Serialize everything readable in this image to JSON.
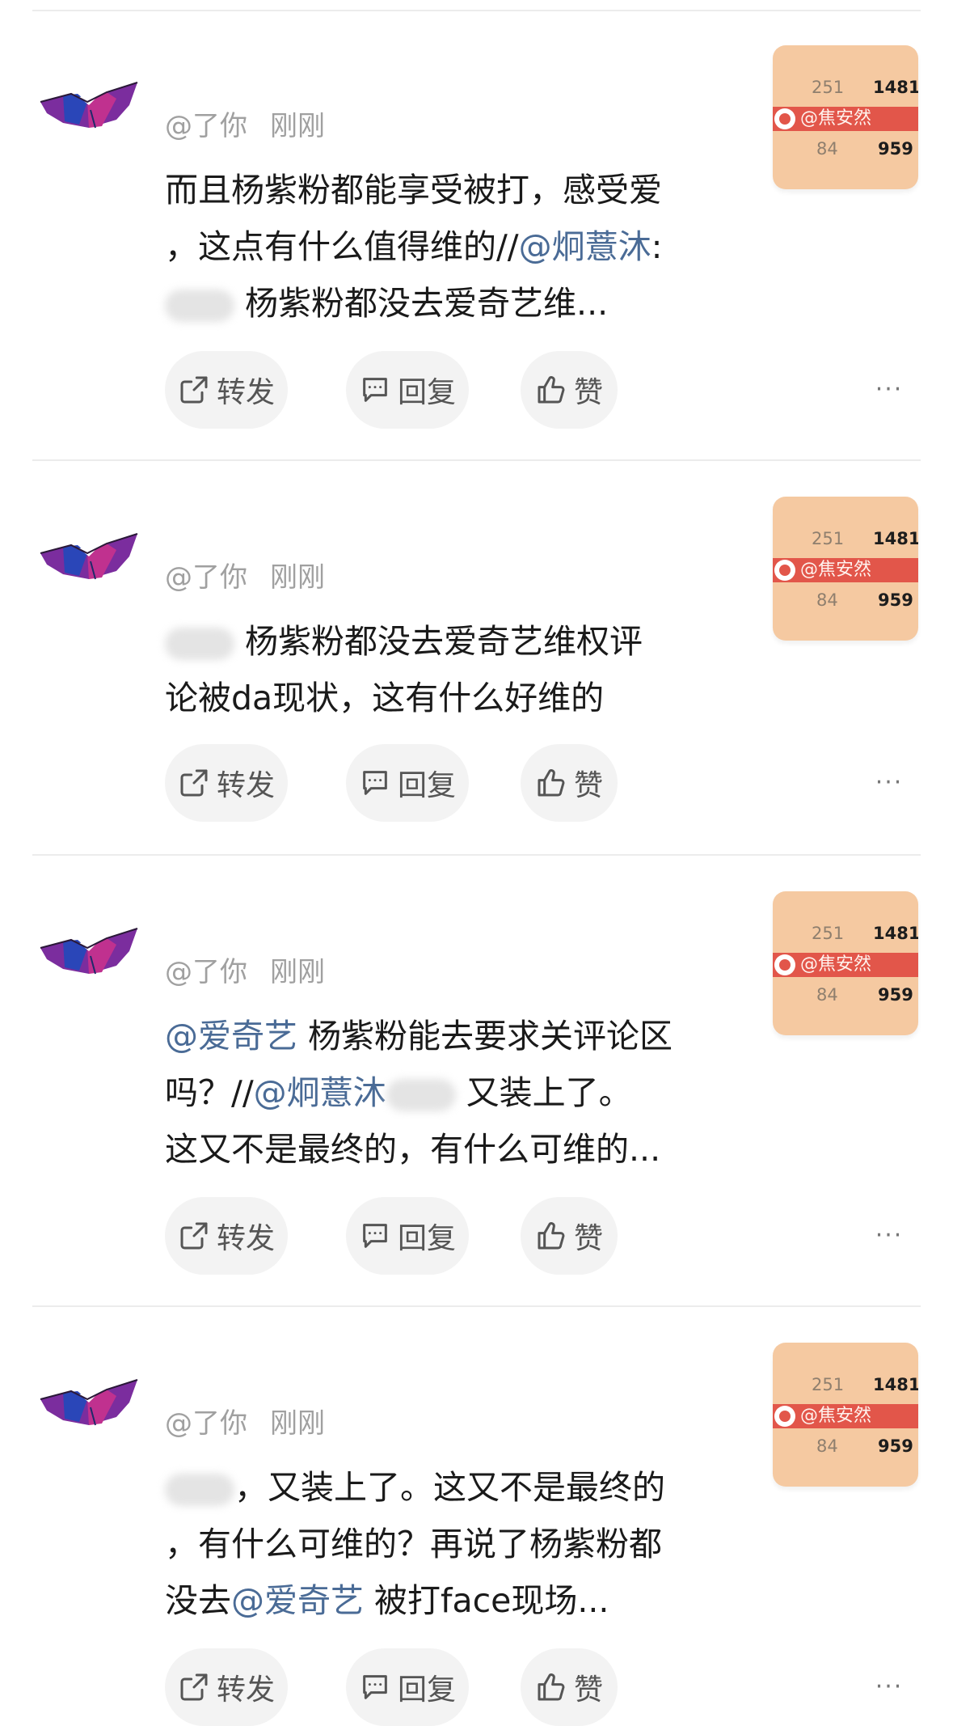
{
  "posts": [
    {
      "user": "@了你",
      "time": "刚刚",
      "lines": [
        [
          {
            "t": "text",
            "v": "而且杨紫粉都能享受被打，感受爱"
          }
        ],
        [
          {
            "t": "text",
            "v": "，这点有什么值得维的//"
          },
          {
            "t": "mention",
            "v": "@炯薏沐"
          },
          {
            "t": "text",
            "v": ":"
          }
        ],
        [
          {
            "t": "blur"
          },
          {
            "t": "text",
            "v": " 杨紫粉都没去爱奇艺维..."
          }
        ]
      ],
      "thumb": {
        "n1": "251",
        "n2": "1481",
        "band": "@焦安然",
        "n3": "84",
        "n4": "959"
      }
    },
    {
      "user": "@了你",
      "time": "刚刚",
      "lines": [
        [
          {
            "t": "blur"
          },
          {
            "t": "text",
            "v": " 杨紫粉都没去爱奇艺维权评"
          }
        ],
        [
          {
            "t": "text",
            "v": "论被da现状，这有什么好维的"
          }
        ]
      ],
      "thumb": {
        "n1": "251",
        "n2": "1481",
        "band": "@焦安然",
        "n3": "84",
        "n4": "959"
      }
    },
    {
      "user": "@了你",
      "time": "刚刚",
      "lines": [
        [
          {
            "t": "mention",
            "v": "@爱奇艺"
          },
          {
            "t": "text",
            "v": " 杨紫粉能去要求关评论区"
          }
        ],
        [
          {
            "t": "text",
            "v": "吗？//"
          },
          {
            "t": "mention",
            "v": "@炯薏沐"
          },
          {
            "t": "blur"
          },
          {
            "t": "text",
            "v": " 又装上了。"
          }
        ],
        [
          {
            "t": "text",
            "v": "这又不是最终的，有什么可维的..."
          }
        ]
      ],
      "thumb": {
        "n1": "251",
        "n2": "1481",
        "band": "@焦安然",
        "n3": "84",
        "n4": "959"
      }
    },
    {
      "user": "@了你",
      "time": "刚刚",
      "lines": [
        [
          {
            "t": "blur"
          },
          {
            "t": "text",
            "v": "，又装上了。这又不是最终的"
          }
        ],
        [
          {
            "t": "text",
            "v": "，有什么可维的？再说了杨紫粉都"
          }
        ],
        [
          {
            "t": "text",
            "v": "没去"
          },
          {
            "t": "mention",
            "v": "@爱奇艺"
          },
          {
            "t": "text",
            "v": " 被打face现场..."
          }
        ]
      ],
      "thumb": {
        "n1": "251",
        "n2": "1481",
        "band": "@焦安然",
        "n3": "84",
        "n4": "959"
      }
    }
  ],
  "actions": {
    "repost": "转发",
    "reply": "回复",
    "like": "赞",
    "more": "···"
  },
  "colors": {
    "mention": "#4a6b96",
    "meta": "#a0a0a0",
    "pill_bg": "#f3f3f3",
    "divider": "#ececec",
    "thumb_bg": "#f5c9a1",
    "thumb_band": "#e2564a"
  }
}
